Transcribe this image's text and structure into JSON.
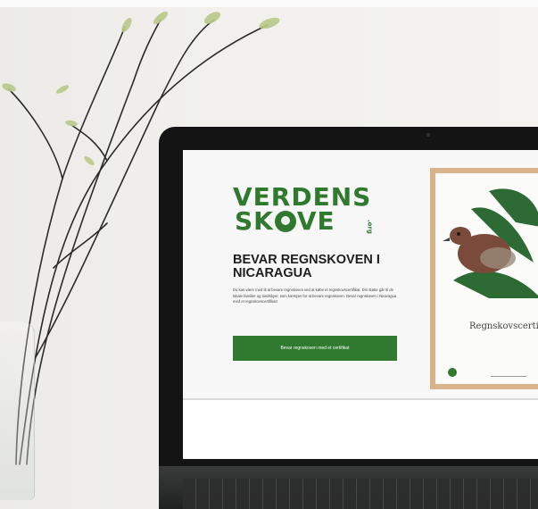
{
  "scene": {
    "description_free": true,
    "colors": {
      "brand_green": "#2f7a2e",
      "frame": "#d9b48b",
      "laptop_bezel": "#141414"
    }
  },
  "website": {
    "logo": {
      "line1": "VERDENS",
      "line2_pre": "SK",
      "line2_post": "VE",
      "suffix": ".org"
    },
    "headline": "BEVAR REGNSKOVEN I NICARAGUA",
    "body": "Du kan være med til at bevare regnskoven ved at købe et regnskovscertifikat. Din støtte går til de lokale familier og landsbyer, som kæmper for at bevare regnskoven. Bevar regnskoven i Nicaragua med et regnskovscertifikat!",
    "cta_label": "Bevar regnskoven med et certifikat",
    "certificate_title": "Regnskovscertifikat"
  }
}
